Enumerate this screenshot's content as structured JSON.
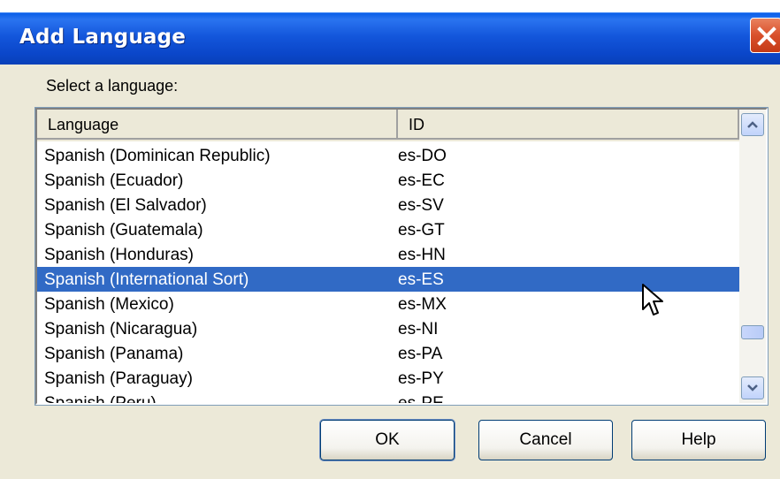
{
  "window": {
    "title": "Add Language"
  },
  "prompt": {
    "label": "Select a language:"
  },
  "list": {
    "columns": {
      "language": "Language",
      "id": "ID"
    },
    "rows": [
      {
        "language": "Spanish (Dominican Republic)",
        "id": "es-DO"
      },
      {
        "language": "Spanish (Ecuador)",
        "id": "es-EC"
      },
      {
        "language": "Spanish (El Salvador)",
        "id": "es-SV"
      },
      {
        "language": "Spanish (Guatemala)",
        "id": "es-GT"
      },
      {
        "language": "Spanish (Honduras)",
        "id": "es-HN"
      },
      {
        "language": "Spanish (International Sort)",
        "id": "es-ES",
        "selected": true
      },
      {
        "language": "Spanish (Mexico)",
        "id": "es-MX"
      },
      {
        "language": "Spanish (Nicaragua)",
        "id": "es-NI"
      },
      {
        "language": "Spanish (Panama)",
        "id": "es-PA"
      },
      {
        "language": "Spanish (Paraguay)",
        "id": "es-PY"
      },
      {
        "language": "Spanish (Peru)",
        "id": "es-PE"
      }
    ]
  },
  "buttons": {
    "ok": "OK",
    "cancel": "Cancel",
    "help": "Help"
  },
  "colors": {
    "titlebar": "#0a46c9",
    "selection": "#316ac5",
    "dialog_bg": "#ece9d8",
    "close": "#d9502b"
  },
  "icons": {
    "close": "close-icon",
    "scroll_up": "chevron-up-icon",
    "scroll_down": "chevron-down-icon",
    "cursor": "mouse-pointer-icon"
  }
}
